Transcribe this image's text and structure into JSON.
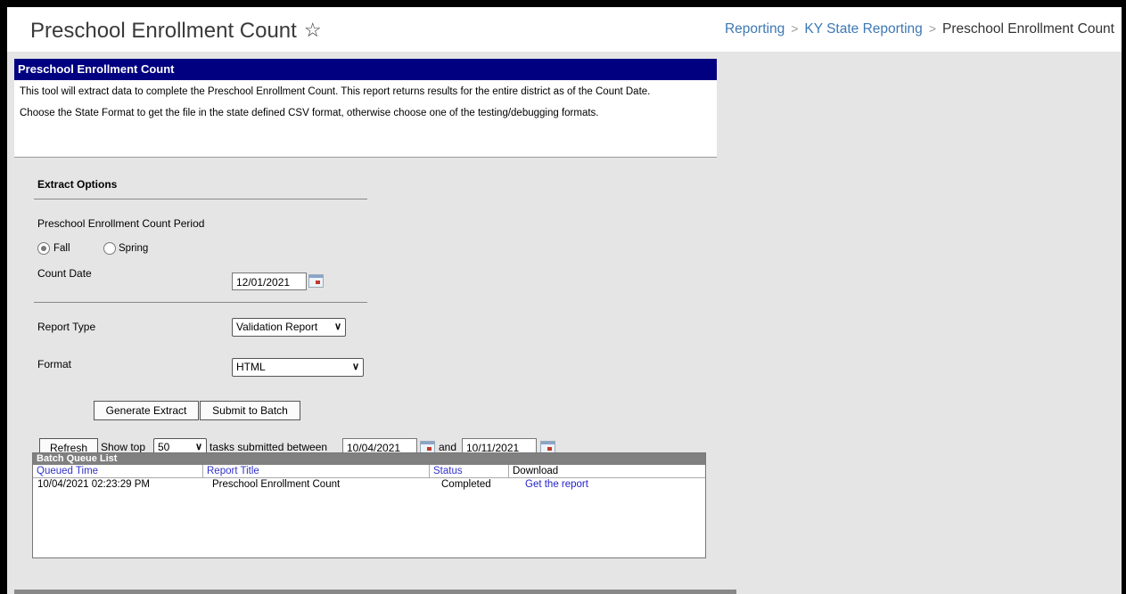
{
  "header": {
    "title": "Preschool Enrollment Count",
    "star_icon": "☆",
    "breadcrumb": [
      "Reporting",
      "KY State Reporting",
      "Preschool Enrollment Count"
    ],
    "breadcrumb_separator": ">"
  },
  "tool": {
    "header": "Preschool Enrollment Count",
    "description_1": "This tool will extract data to complete the Preschool Enrollment Count. This report returns results for the entire district as of the Count Date.",
    "description_2": "Choose the State Format to get the file in the state defined CSV format, otherwise choose one of the testing/debugging formats."
  },
  "options": {
    "heading": "Extract Options",
    "period_label": "Preschool Enrollment Count Period",
    "period_options": [
      "Fall",
      "Spring"
    ],
    "period_selected": "Fall",
    "count_date_label": "Count Date",
    "count_date_value": "12/01/2021",
    "report_type_label": "Report Type",
    "report_type_value": "Validation Report",
    "format_label": "Format",
    "format_value": "HTML"
  },
  "buttons": {
    "generate": "Generate Extract",
    "submit": "Submit to Batch"
  },
  "batch_controls": {
    "refresh": "Refresh",
    "show_top_label": "Show top",
    "show_top_value": "50",
    "between_label": "tasks submitted between",
    "start_date": "10/04/2021",
    "and_label": "and",
    "end_date": "10/11/2021"
  },
  "batch_queue": {
    "title": "Batch Queue List",
    "columns": [
      "Queued Time",
      "Report Title",
      "Status",
      "Download"
    ],
    "rows": [
      {
        "queued_time": "10/04/2021 02:23:29 PM",
        "report_title": "Preschool Enrollment Count",
        "status": "Completed",
        "download": "Get the report"
      }
    ]
  },
  "colors": {
    "tool_header_bg": "#000080",
    "breadcrumb_link": "#3c78b5",
    "batch_header_bg": "#808080",
    "content_bg": "#e5e5e5"
  }
}
